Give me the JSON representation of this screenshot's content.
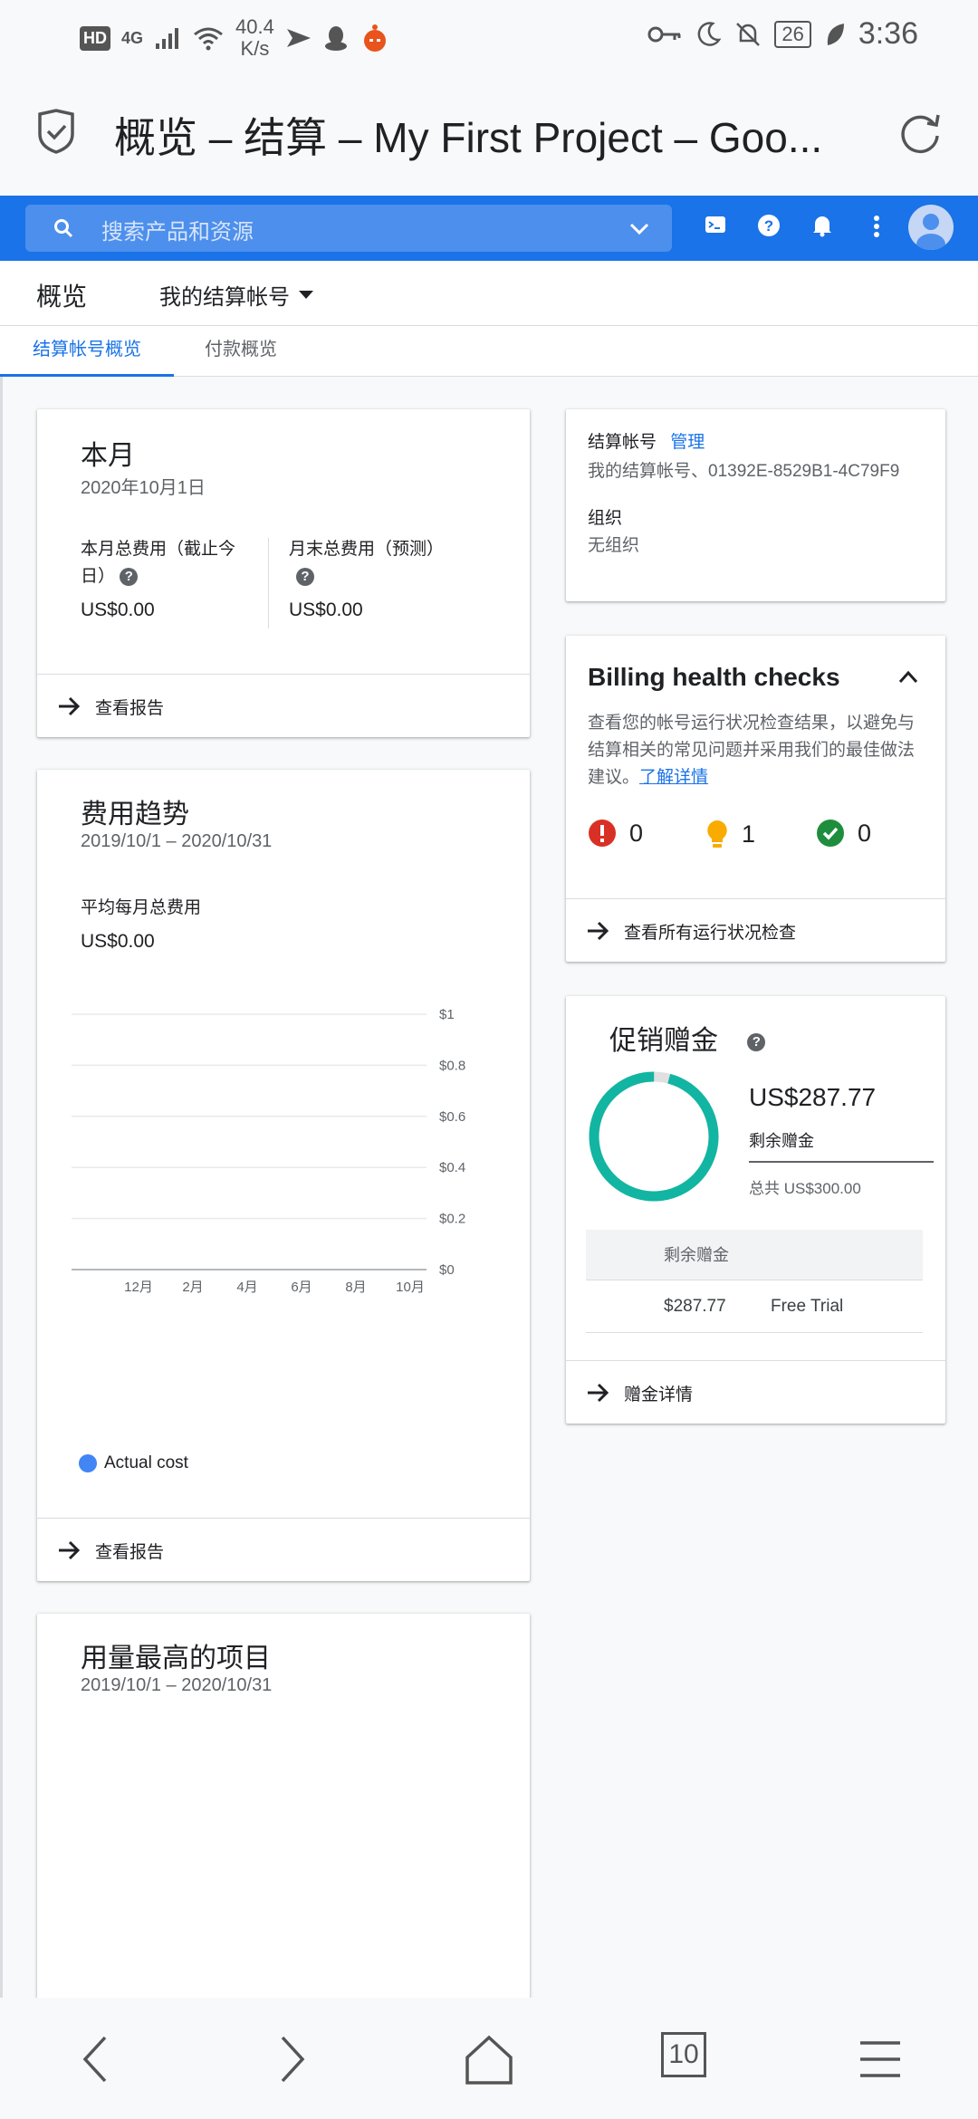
{
  "status_bar": {
    "hd": "HD",
    "network": "4G",
    "speed_value": "40.4",
    "speed_unit": "K/s",
    "battery": "26",
    "time": "3:36"
  },
  "browser": {
    "page_title": "概览 – 结算 – My First Project – Goo...",
    "tab_count": "10"
  },
  "header": {
    "search_placeholder": "搜索产品和资源",
    "brand_color": "#1a73e8"
  },
  "page": {
    "title": "概览",
    "account_selector": "我的结算帐号"
  },
  "tabs": [
    {
      "label": "结算帐号概览",
      "active": true
    },
    {
      "label": "付款概览",
      "active": false
    }
  ],
  "this_month": {
    "title": "本月",
    "date": "2020年10月1日",
    "cost_to_date_label": "本月总费用（截止今日）",
    "cost_to_date_value": "US$0.00",
    "forecast_label": "月末总费用（预测）",
    "forecast_value": "US$0.00",
    "footer_link": "查看报告"
  },
  "cost_trend": {
    "title": "费用趋势",
    "range": "2019/10/1 – 2020/10/31",
    "avg_label": "平均每月总费用",
    "avg_value": "US$0.00",
    "footer_link": "查看报告"
  },
  "chart_data": {
    "type": "line",
    "title": "",
    "x": [
      "12月",
      "2月",
      "4月",
      "6月",
      "8月",
      "10月"
    ],
    "y_ticks": [
      "$0",
      "$0.2",
      "$0.4",
      "$0.6",
      "$0.8",
      "$1"
    ],
    "ylim": [
      0,
      1
    ],
    "series": [
      {
        "name": "Actual cost",
        "values": [
          0,
          0,
          0,
          0,
          0,
          0
        ],
        "color": "#4285f4"
      }
    ],
    "legend_position": "bottom-left",
    "grid": true
  },
  "top_projects": {
    "title": "用量最高的项目",
    "range": "2019/10/1 – 2020/10/31"
  },
  "billing_account": {
    "label": "结算帐号",
    "manage_link": "管理",
    "account_text": "我的结算帐号、01392E-8529B1-4C79F9",
    "org_label": "组织",
    "org_value": "无组织"
  },
  "health_checks": {
    "title": "Billing health checks",
    "description_pre": "查看您的帐号运行状况检查结果，以避免与结算相关的常见问题并采用我们的最佳做法建议。",
    "learn_more": "了解详情",
    "errors": "0",
    "warnings": "1",
    "passed": "0",
    "footer_link": "查看所有运行状况检查",
    "error_color": "#d93025",
    "warning_color": "#f9ab00",
    "ok_color": "#1e8e3e"
  },
  "promo": {
    "title": "促销赠金",
    "remaining_value": "US$287.77",
    "remaining_label": "剩余赠金",
    "total_label": "总共 US$300.00",
    "used_fraction": 0.0408,
    "ring_color": "#12b5a2",
    "table_header": "剩余赠金",
    "row_amount": "$287.77",
    "row_name": "Free Trial",
    "footer_link": "赠金详情"
  }
}
